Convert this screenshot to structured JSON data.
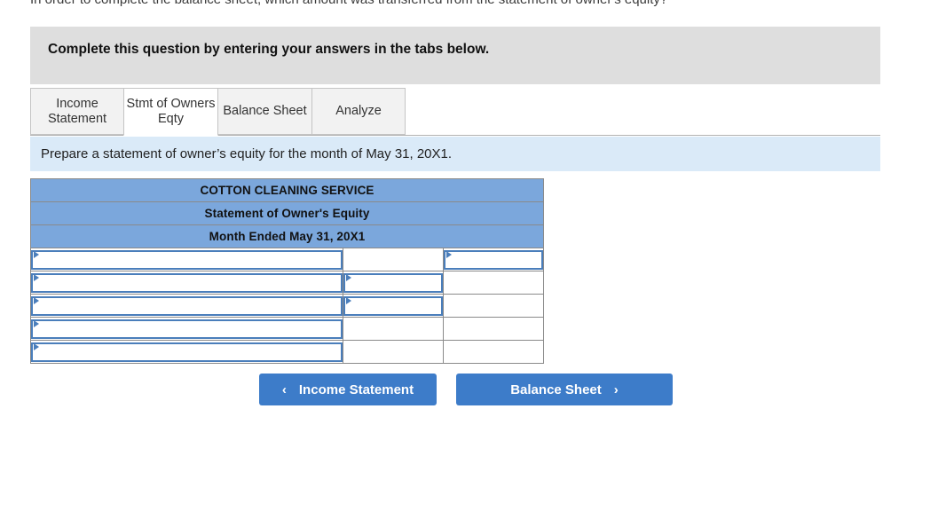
{
  "cutoff_question": "In order to complete the balance sheet, which amount was transferred from the statement of owner's equity?",
  "callout": {
    "text": "Complete this question by entering your answers in the tabs below."
  },
  "tabs": [
    {
      "label": "Income Statement",
      "active": false,
      "name": "tab-income-statement"
    },
    {
      "label": "Stmt of Owners Eqty",
      "active": true,
      "name": "tab-stmt-owners-eqty"
    },
    {
      "label": "Balance Sheet",
      "active": false,
      "name": "tab-balance-sheet"
    },
    {
      "label": "Analyze",
      "active": false,
      "name": "tab-analyze"
    }
  ],
  "instruction": {
    "text": "Prepare a statement of owner’s equity for the month of May 31, 20X1."
  },
  "statement": {
    "header_lines": [
      "COTTON CLEANING SERVICE",
      "Statement of Owner's Equity",
      "Month Ended May 31, 20X1"
    ],
    "rows": [
      {
        "label": "",
        "amount1": "",
        "amount2": ""
      },
      {
        "label": "",
        "amount1": "",
        "amount2": ""
      },
      {
        "label": "",
        "amount1": "",
        "amount2": ""
      },
      {
        "label": "",
        "amount1": "",
        "amount2": ""
      },
      {
        "label": "",
        "amount1": "",
        "amount2": ""
      }
    ]
  },
  "nav": {
    "prev_label": "Income Statement",
    "prev_chevron": "‹",
    "next_label": "Balance Sheet",
    "next_chevron": "›"
  },
  "colors": {
    "header_blue": "#7BA7DC",
    "instruction_blue": "#daeaf8",
    "callout_gray": "#dedede",
    "button_blue": "#3d7cc9",
    "field_border": "#4a7ebb"
  }
}
